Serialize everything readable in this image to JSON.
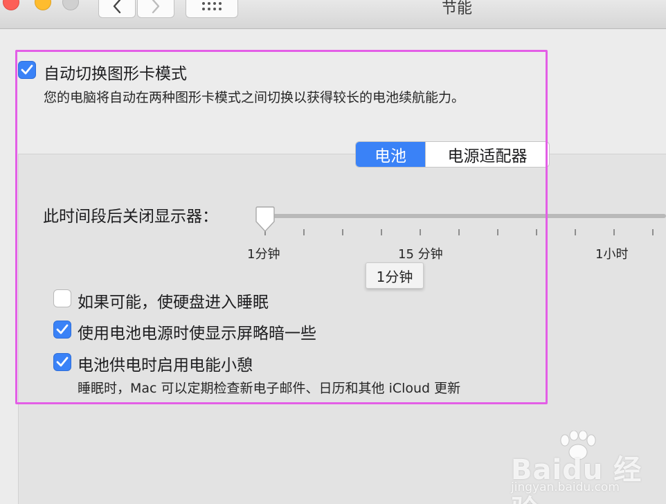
{
  "window": {
    "title": "节能",
    "back_icon": "chevron-left-icon",
    "forward_icon": "chevron-right-icon",
    "grid_icon": "grid-icon"
  },
  "graphics_switching": {
    "checked": true,
    "label": "自动切换图形卡模式",
    "description": "您的电脑将自动在两种图形卡模式之间切换以获得较长的电池续航能力。"
  },
  "tabs": {
    "items": [
      {
        "label": "电池",
        "active": true
      },
      {
        "label": "电源适配器",
        "active": false
      }
    ]
  },
  "display_sleep": {
    "label": "此时间段后关闭显示器：",
    "value": "1分钟",
    "tick_labels": [
      "1分钟",
      "15 分钟",
      "1小时"
    ],
    "tooltip": "1分钟"
  },
  "options": [
    {
      "checked": false,
      "label": "如果可能，使硬盘进入睡眠"
    },
    {
      "checked": true,
      "label": "使用电池电源时使显示屏略暗一些"
    },
    {
      "checked": true,
      "label": "电池供电时启用电能小憩",
      "note": "睡眠时，Mac 可以定期检查新电子邮件、日历和其他 iCloud 更新"
    }
  ],
  "watermark": {
    "brand": "Baidu 经验",
    "url": "jingyan.baidu.com"
  },
  "colors": {
    "accent": "#3a82f7",
    "highlight": "#e35ee6"
  }
}
